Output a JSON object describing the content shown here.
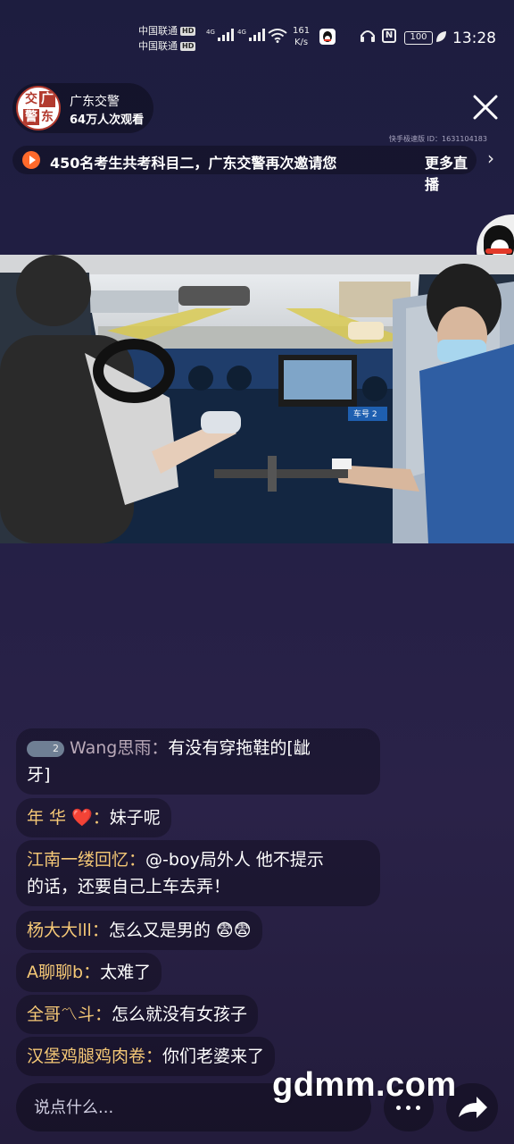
{
  "status_bar": {
    "carrier_1": "中国联通",
    "carrier_2": "中国联通",
    "hd": "HD",
    "net_type_1": "4G",
    "net_type_2": "4G",
    "speed_value": "161",
    "speed_unit": "K/s",
    "battery": "100",
    "time": "13:28",
    "nfc_label": "N"
  },
  "streamer": {
    "avatar_chars": [
      "交",
      "广",
      "警",
      "东"
    ],
    "name": "广东交警",
    "views": "64万人次观看"
  },
  "version_id": "快手极速版 ID：1631104183",
  "live_title": {
    "text": "450名考生共考科目二，广东交警再次邀请您",
    "more_label": "更多直播"
  },
  "video": {
    "plate_tag": "车号 2"
  },
  "comments": [
    {
      "badge": "2",
      "user": "Wang思雨",
      "sep": "：",
      "text": "有没有穿拖鞋的[龇",
      "text_line2": "牙]"
    },
    {
      "user": "年 华",
      "heart": "❤️",
      "sep": "：",
      "text": "妹子呢"
    },
    {
      "user": "江南一缕回忆",
      "sep": "：",
      "text": "@-boy局外人 他不提示",
      "text_line2": "的话，还要自己上车去弄！"
    },
    {
      "user": "杨大大lll",
      "sep": "：",
      "text": "怎么又是男的 😨😨"
    },
    {
      "user": "A聊聊b",
      "sep": "：",
      "text": "太难了"
    },
    {
      "user": "全哥〽斗",
      "sep": "：",
      "text": "怎么就没有女孩子"
    },
    {
      "user": "汉堡鸡腿鸡肉卷",
      "sep": "：",
      "text": "你们老婆来了"
    }
  ],
  "bottom_bar": {
    "input_placeholder": "说点什么..."
  },
  "watermark": "gdmm.com",
  "colors": {
    "username": "#f5c876",
    "accent_play": "#ff6a2b",
    "background_top": "#1d1d3f"
  }
}
